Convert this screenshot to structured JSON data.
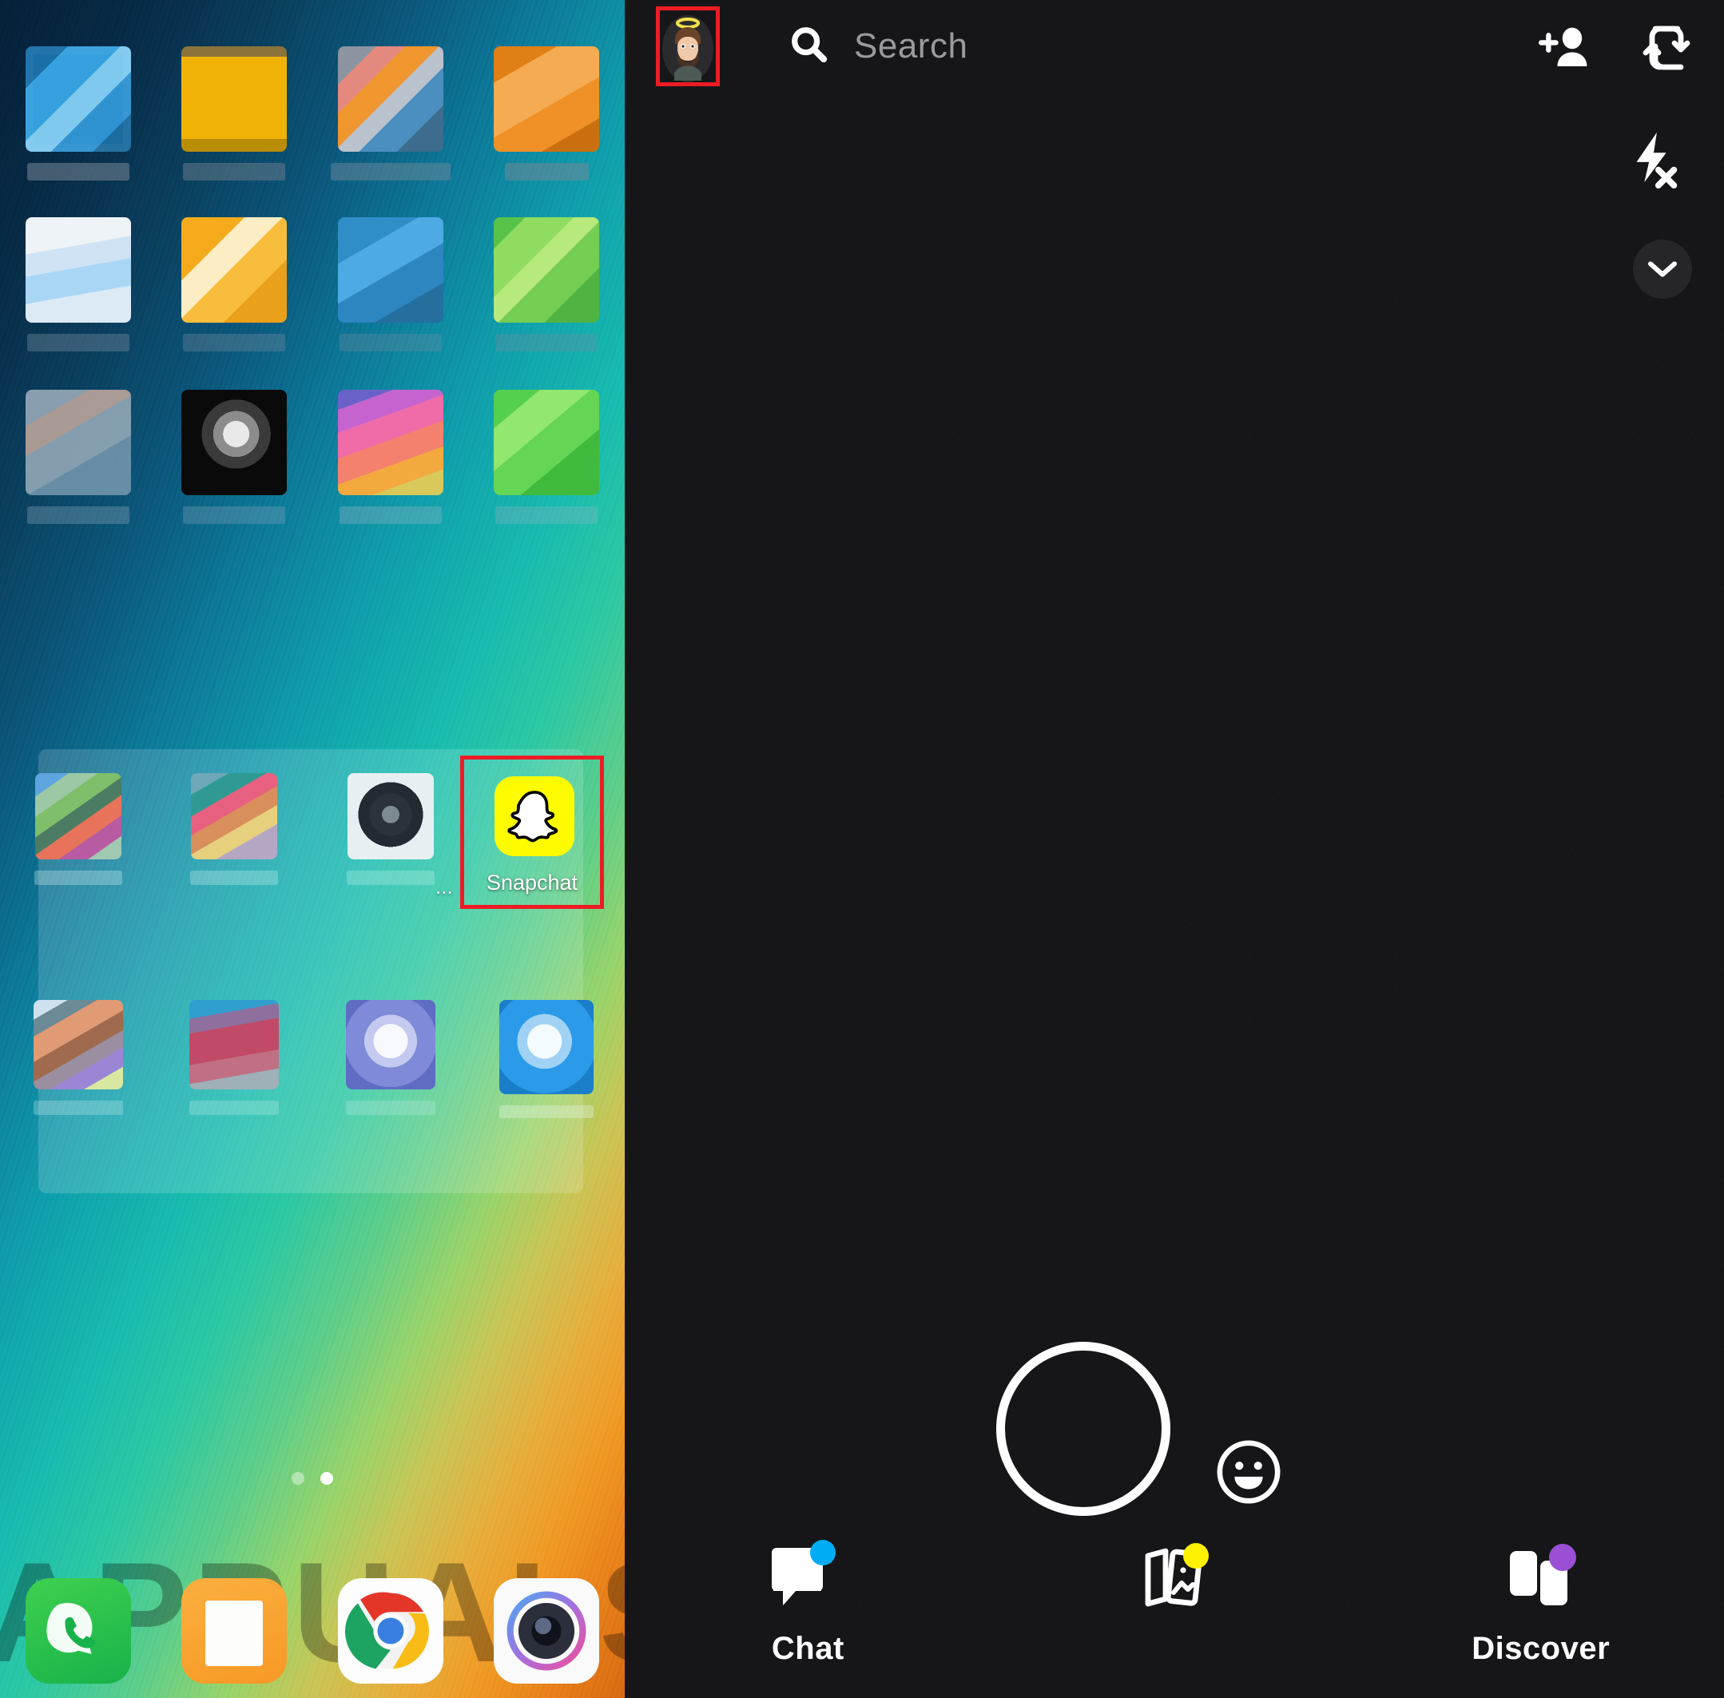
{
  "left_phone": {
    "name": "android-home-screen",
    "wallpaper_description": "blue-to-teal-to-orange gradient",
    "watermark_text": "APPUALS",
    "app_grid": {
      "rows": [
        {
          "apps": [
            {
              "label": "",
              "icon": "blurred-app-icon",
              "colors": [
                "#2d9fe0",
                "#1b7fc4"
              ]
            },
            {
              "label": "",
              "icon": "blurred-app-icon",
              "colors": [
                "#f2b705",
                "#d99f04"
              ]
            },
            {
              "label": "",
              "icon": "blurred-app-icon",
              "colors": [
                "#8a96a4",
                "#e2925e"
              ]
            },
            {
              "label": "",
              "icon": "blurred-app-icon",
              "colors": [
                "#f0962e",
                "#e8b06a"
              ]
            }
          ]
        },
        {
          "apps": [
            {
              "label": "",
              "icon": "blurred-app-icon",
              "colors": [
                "#f2f6fa",
                "#b8dcf5"
              ]
            },
            {
              "label": "",
              "icon": "blurred-app-icon",
              "colors": [
                "#f8b125",
                "#fdecc0"
              ]
            },
            {
              "label": "",
              "icon": "blurred-app-icon",
              "colors": [
                "#2b8fd6",
                "#3aa0e3"
              ]
            },
            {
              "label": "",
              "icon": "blurred-app-icon",
              "colors": [
                "#6cc644",
                "#9fe06a"
              ]
            }
          ]
        },
        {
          "apps": [
            {
              "label": "",
              "icon": "blurred-app-icon",
              "colors": [
                "#8f9fad",
                "#b0a29c"
              ]
            },
            {
              "label": "",
              "icon": "blurred-app-icon",
              "colors": [
                "#0d0d0d",
                "#d8d8d8"
              ]
            },
            {
              "label": "",
              "icon": "blurred-app-icon",
              "colors": [
                "#d64fae",
                "#f0853f"
              ]
            },
            {
              "label": "",
              "icon": "blurred-app-icon",
              "colors": [
                "#4fd44f",
                "#8de86b"
              ]
            }
          ]
        },
        {
          "apps": [
            {
              "label": "",
              "icon": "blurred-app-icon",
              "colors": [
                "#5ea4e0",
                "#c96b8f"
              ]
            },
            {
              "label": "",
              "icon": "blurred-app-icon",
              "colors": [
                "#3da8a0",
                "#e8627f"
              ]
            },
            {
              "label": "",
              "icon": "blurred-app-icon",
              "colors": [
                "#eef4f6",
                "#2c3440"
              ]
            },
            {
              "label": "Snapchat",
              "icon": "snapchat-icon",
              "colors": [
                "#fffc00"
              ]
            }
          ]
        },
        {
          "apps": [
            {
              "label": "",
              "icon": "blurred-app-icon",
              "colors": [
                "#d89070",
                "#9b86d6"
              ]
            },
            {
              "label": "",
              "icon": "blurred-app-icon",
              "colors": [
                "#c14a66",
                "#3aa6c6"
              ]
            },
            {
              "label": "",
              "icon": "blurred-app-icon",
              "colors": [
                "#6f7fd0",
                "#f4f6fb"
              ]
            },
            {
              "label": "",
              "icon": "blurred-app-icon",
              "colors": [
                "#1f8fe0",
                "#eaf4fd"
              ]
            }
          ]
        }
      ],
      "overflow_ellipsis": "..."
    },
    "page_indicator": {
      "total": 2,
      "active_index": 1
    },
    "dock": [
      {
        "label": "",
        "icon": "whatsapp-icon"
      },
      {
        "label": "",
        "icon": "notes-icon"
      },
      {
        "label": "",
        "icon": "chrome-icon"
      },
      {
        "label": "",
        "icon": "camera-icon"
      }
    ],
    "highlight_color": "#ed1c24"
  },
  "snapchat_app": {
    "name": "snapchat-camera-screen",
    "background_color": "#161618",
    "top_bar": {
      "avatar": {
        "name": "bitmoji-avatar",
        "has_halo": true,
        "halo_color": "#f2e14c",
        "highlighted": true
      },
      "search": {
        "icon": "search-icon",
        "placeholder": "Search"
      },
      "add_friend_icon": "add-friend-icon",
      "flip_camera_icon": "flip-camera-icon",
      "flash_icon": "flash-off-icon",
      "chevron_icon": "chevron-down-icon"
    },
    "capture": {
      "shutter_label": "",
      "shutter_icon": "shutter-ring",
      "lens_icon": "smiley-lens-icon"
    },
    "bottom_nav": [
      {
        "label": "Chat",
        "icon": "chat-bubble-icon",
        "badge_color": "#00adf5"
      },
      {
        "label": "",
        "icon": "memories-cards-icon",
        "badge_color": "#fff200"
      },
      {
        "label": "Discover",
        "icon": "discover-cards-icon",
        "badge_color": "#9a4fd4"
      }
    ]
  }
}
